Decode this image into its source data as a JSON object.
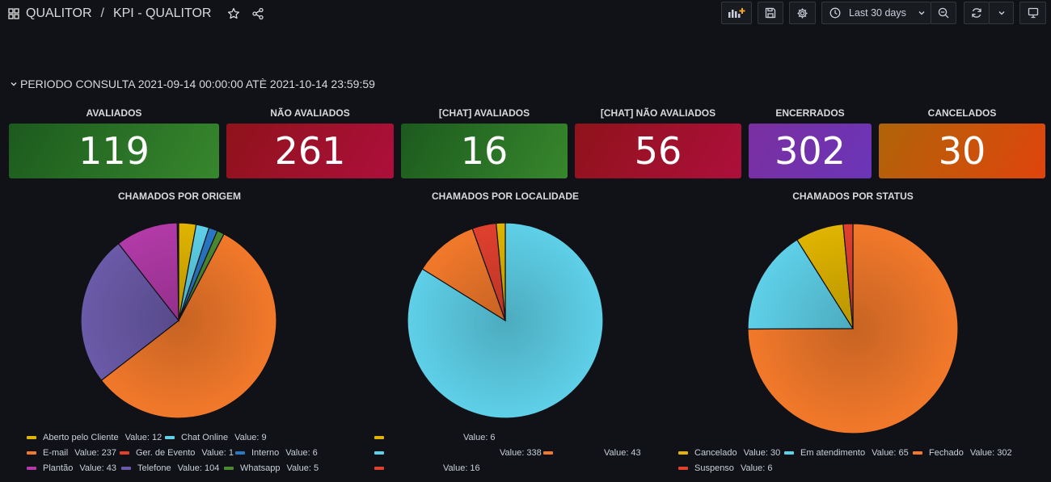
{
  "header": {
    "breadcrumb_folder": "QUALITOR",
    "breadcrumb_sep": "/",
    "dashboard_title": "KPI - QUALITOR",
    "time_range": "Last 30 days"
  },
  "row": {
    "title": "PERIODO CONSULTA 2021-09-14 00:00:00 ATÈ 2021-10-14 23:59:59"
  },
  "stats": [
    {
      "title": "AVALIADOS",
      "value": "119",
      "color_from": "#1c5a1e",
      "color_to": "#37872d"
    },
    {
      "title": "NÃO AVALIADOS",
      "value": "261",
      "color_from": "#8f131b",
      "color_to": "#ad0f3b"
    },
    {
      "title": "[CHAT] AVALIADOS",
      "value": "16",
      "color_from": "#1c5a1e",
      "color_to": "#37872d"
    },
    {
      "title": "[CHAT] NÃO AVALIADOS",
      "value": "56",
      "color_from": "#8f131b",
      "color_to": "#ad0f3b"
    },
    {
      "title": "ENCERRADOS",
      "value": "302",
      "color_from": "#7a2fa0",
      "color_to": "#6b35b8"
    },
    {
      "title": "CANCELADOS",
      "value": "30",
      "color_from": "#b0640a",
      "color_to": "#e0440b"
    }
  ],
  "chart_data": [
    {
      "type": "pie",
      "title": "CHAMADOS POR ORIGEM",
      "series": [
        {
          "name": "Aberto pelo Cliente",
          "value": 12,
          "color": "#e0b400"
        },
        {
          "name": "Chat Online",
          "value": 9,
          "color": "#5ed0e8"
        },
        {
          "name": "E-mail",
          "value": 237,
          "color": "#f2792b"
        },
        {
          "name": "Ger. de Evento",
          "value": 1,
          "color": "#e0402e"
        },
        {
          "name": "Interno",
          "value": 6,
          "color": "#2a77c4"
        },
        {
          "name": "Plantão",
          "value": 43,
          "color": "#b23aa8"
        },
        {
          "name": "Telefone",
          "value": 104,
          "color": "#6a5aa8"
        },
        {
          "name": "Whatsapp",
          "value": 5,
          "color": "#4b8a2e"
        }
      ],
      "slice_order": [
        0,
        1,
        4,
        7,
        2,
        6,
        5
      ],
      "value_label": "Value:"
    },
    {
      "type": "pie",
      "title": "CHAMADOS POR LOCALIDADE",
      "series": [
        {
          "name": "",
          "value": 6,
          "color": "#e0b400"
        },
        {
          "name": "",
          "value": 338,
          "color": "#5ed0e8"
        },
        {
          "name": "",
          "value": 43,
          "color": "#f2792b"
        },
        {
          "name": "",
          "value": 16,
          "color": "#e0402e"
        }
      ],
      "slice_order": [
        1,
        2,
        3,
        0
      ],
      "value_label": "Value:"
    },
    {
      "type": "pie",
      "title": "CHAMADOS POR STATUS",
      "series": [
        {
          "name": "Cancelado",
          "value": 30,
          "color": "#e0b400"
        },
        {
          "name": "Em atendimento",
          "value": 65,
          "color": "#5ed0e8"
        },
        {
          "name": "Fechado",
          "value": 302,
          "color": "#f2792b"
        },
        {
          "name": "Suspenso",
          "value": 6,
          "color": "#e0402e"
        }
      ],
      "slice_order": [
        2,
        1,
        0,
        3
      ],
      "value_label": "Value:"
    }
  ]
}
